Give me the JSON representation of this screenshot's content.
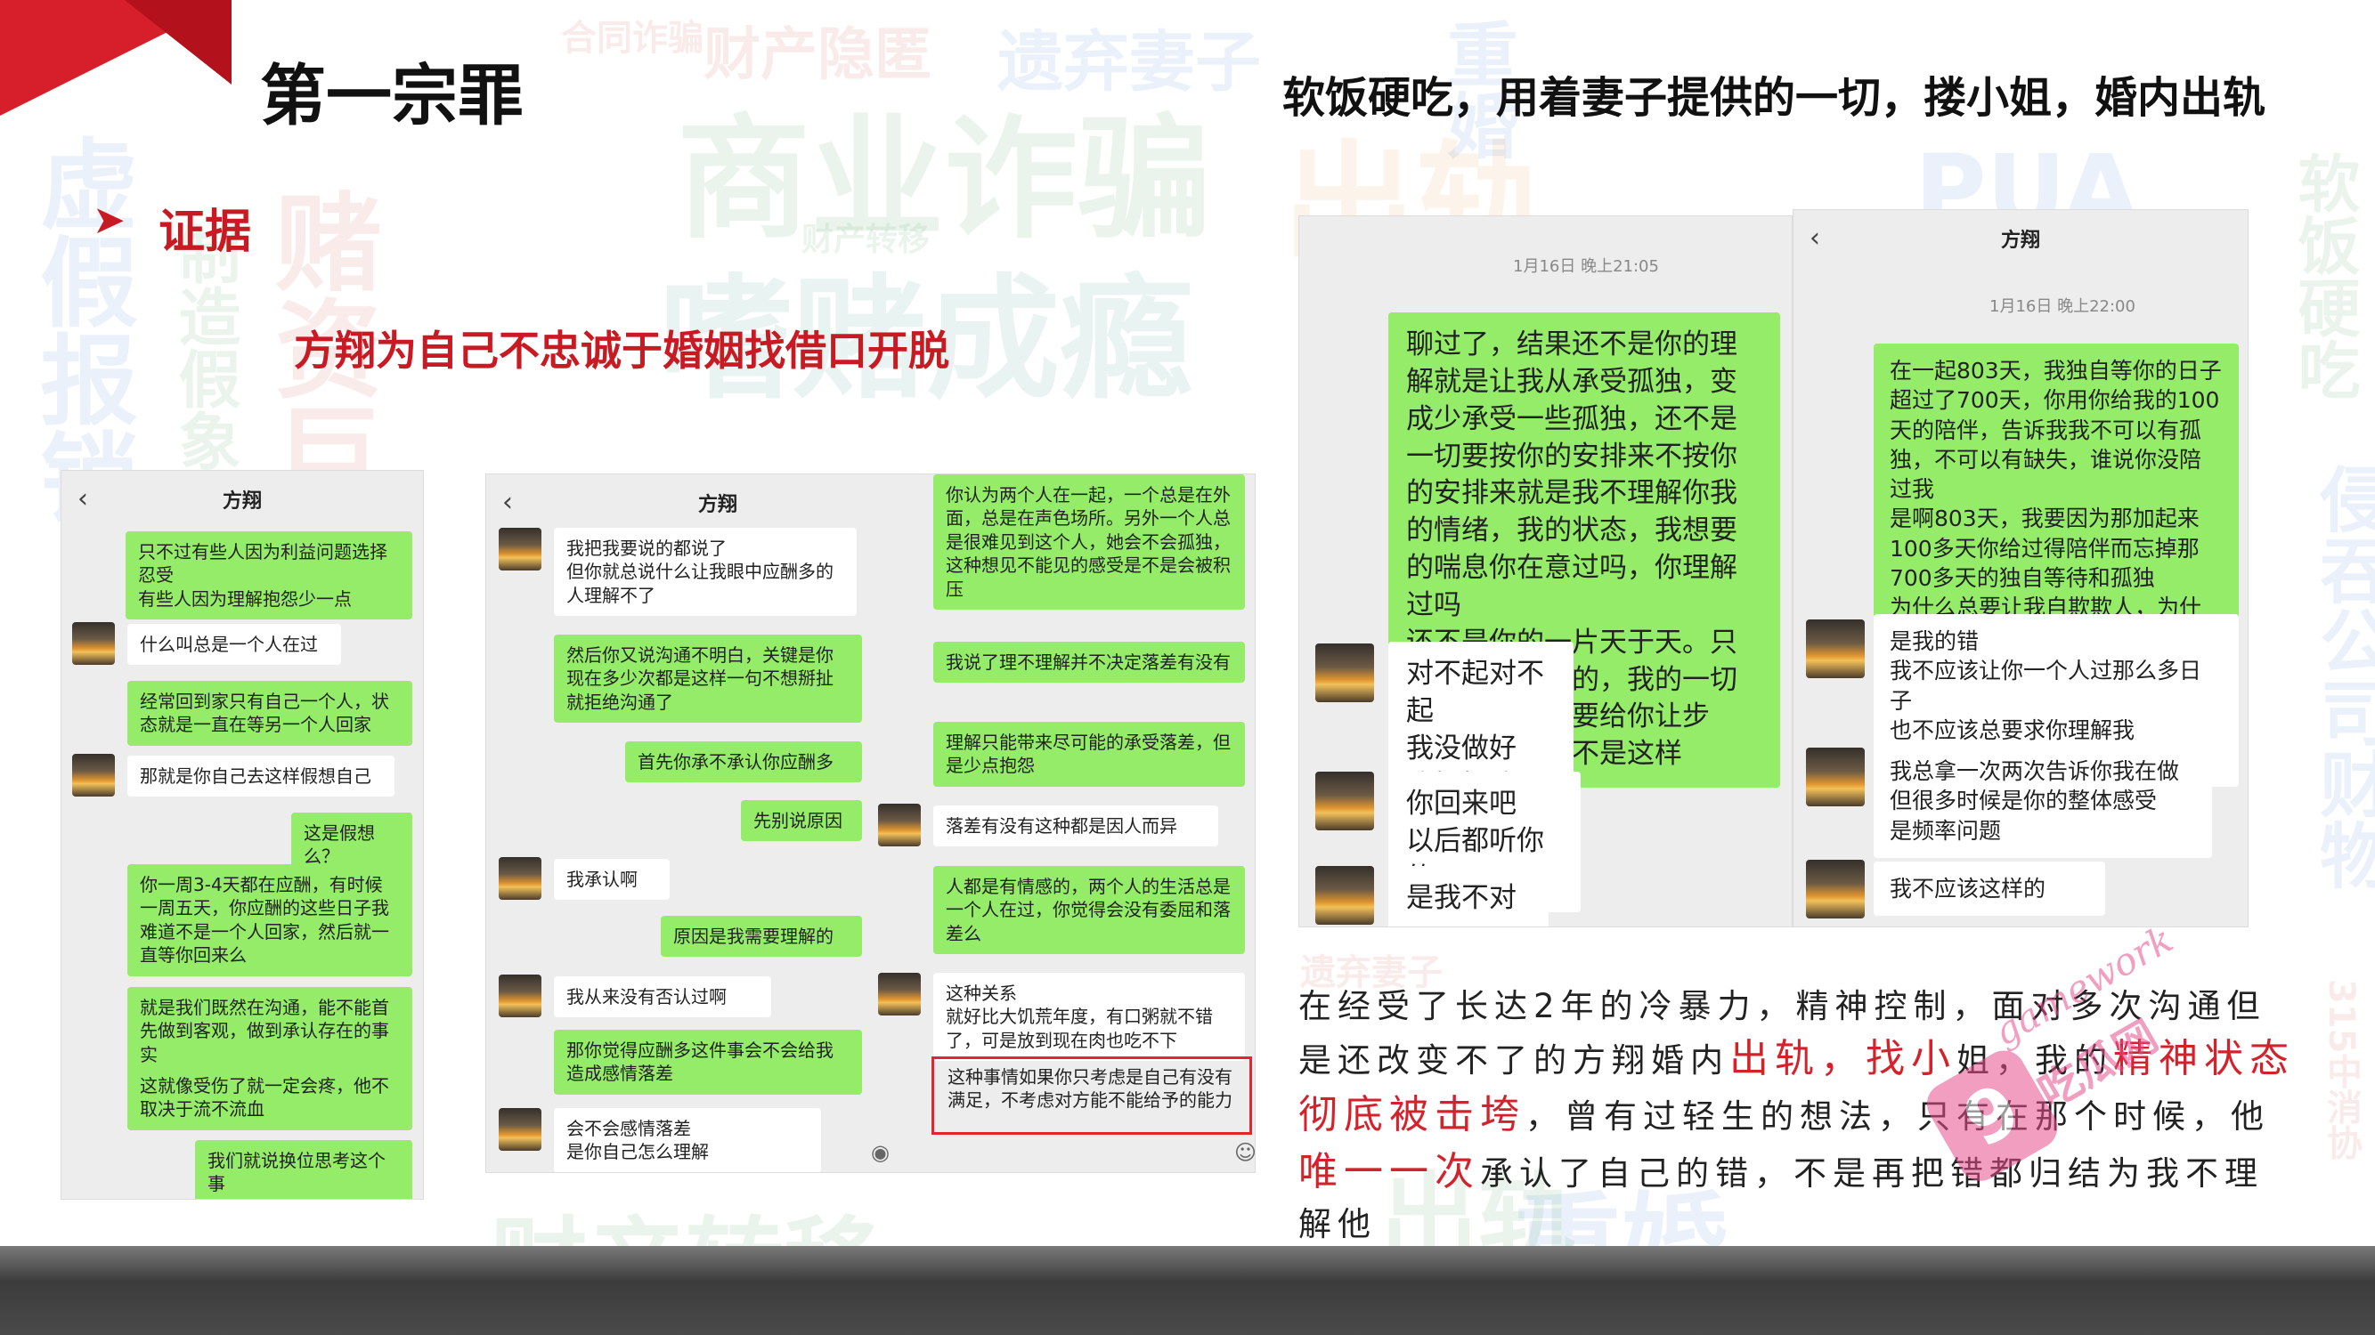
{
  "slide": {
    "title": "第一宗罪",
    "subtitle": "软饭硬吃，用着妻子提供的一切，搂小姐，婚内出轨",
    "section_label": "证据",
    "headline": "方翔为自己不忠诚于婚姻找借口开脱"
  },
  "background_words": [
    "商业诈骗",
    "遗弃妻子",
    "财产隐匿",
    "嗜赌成瘾",
    "虚假报销",
    "赌资巨大",
    "合同诈骗",
    "财产转移",
    "重婚",
    "出轨",
    "软饭硬吃",
    "侵吞公司财物",
    "PUA",
    "315中消协",
    "制造假象",
    "出轨",
    "重婚",
    "遗弃妻子",
    "PUA",
    "财产转移"
  ],
  "chat1": {
    "title": "方翔",
    "back_icon": "‹",
    "messages": [
      "只不过有些人因为利益问题选择忍受\n有些人因为理解抱怨少一点",
      "什么叫总是一个人在过",
      "经常回到家只有自己一个人，状态就是一直在等另一个人回家",
      "那就是你自己去这样假想自己",
      "这是假想么？",
      "你一周3-4天都在应酬，有时候一周五天，你应酬的这些日子我难道不是一个人回家，然后就一直等你回来么",
      "就是我们既然在沟通，能不能首先做到客观，做到承认存在的事实",
      "这就像受伤了就一定会疼，他不取决于流不流血",
      "我们就说换位思考这个事"
    ]
  },
  "chat2": {
    "title": "方翔",
    "back_icon": "‹",
    "left_col": [
      "我把我要说的都说了\n但你就总说什么让我眼中应酬多的人理解不了",
      "然后你又说沟通不明白，关键是你现在多少次都是这样一句不想掰扯就拒绝沟通了",
      "首先你承不承认你应酬多",
      "先别说原因",
      "我承认啊",
      "原因是我需要理解的",
      "我从来没有否认过啊",
      "那你觉得应酬多这件事会不会给我造成感情落差",
      "会不会感情落差\n是你自己怎么理解"
    ],
    "right_col": [
      "你认为两个人在一起，一个总是在外面，总是在声色场所。另外一个人总是很难见到这个人，她会不会孤独，这种想见不能见的感受是不是会被积压",
      "我说了理不理解并不决定落差有没有",
      "理解只能带来尽可能的承受落差，但是少点抱怨",
      "落差有没有这种都是因人而异",
      "人都是有情感的，两个人的生活总是一个人在过，你觉得会没有委屈和落差么",
      "这种关系\n就好比大饥荒年度，有口粥就不错了，可是放到现在肉也吃不下",
      "这种事情如果你只考虑是自己有没有满足，不考虑对方能不能给予的能力"
    ]
  },
  "chat3": {
    "title": "方翔",
    "back_icon": "‹",
    "timestamp": "1月16日 晚上21:05",
    "messages": [
      "聊过了，结果还不是你的理解就是让我从承受孤独，变成少承受一些孤独，还不是一切要按你的安排来不按你的安排来就是我不理解你我的情绪，我的状态，我想要的喘息你在意过吗，你理解过吗\n还不是你的一片天于天。只要遇到你想做的，我的一切连我的生命都要给你让步\n两年了，哪次不是这样",
      "对不起对不起\n我没做好\n我好好改",
      "你回来吧\n以后都听你的",
      "是我不对"
    ]
  },
  "chat4": {
    "title": "方翔",
    "back_icon": "‹",
    "timestamp": "1月16日 晚上22:00",
    "messages": [
      "在一起803天，我独自等你的日子超过了700天，你用你给我的100天的陪伴，告诉我我不可以有孤独，不可以有缺失，谁说你没陪过我\n是啊803天，我要因为那加起来100多天你给过得陪伴而忘掉那700多天的独自等待和孤独\n为什么总要让我自欺欺人，为什么",
      "是我的错\n我不应该让你一个人过那么多日子\n也不应该总要求你理解我\n而自己不去真正理解你",
      "我总拿一次两次告诉你我在做\n但很多时候是你的整体感受\n是频率问题",
      "我不应该这样的"
    ]
  },
  "description": {
    "p1": "在经受了长达2年的冷暴力，精神控制，面对多次沟通但是还改变不了的方翔婚内",
    "hl1": "出轨，找小",
    "p2": "姐，我的",
    "hl2": "精神状态彻底被击垮",
    "p3": "，曾有过轻生的想法，只有在那个时候，他",
    "hl3": "唯一一次",
    "p4": "承认了自己的错，不是再把错都归结为我不理解他"
  },
  "watermark": {
    "badge": "9",
    "text1": "gamework",
    "text2": "吃瓜网"
  },
  "colors": {
    "accent_red": "#d61f2b",
    "bubble_green": "#95ec69",
    "chat_bg": "#ededed"
  }
}
